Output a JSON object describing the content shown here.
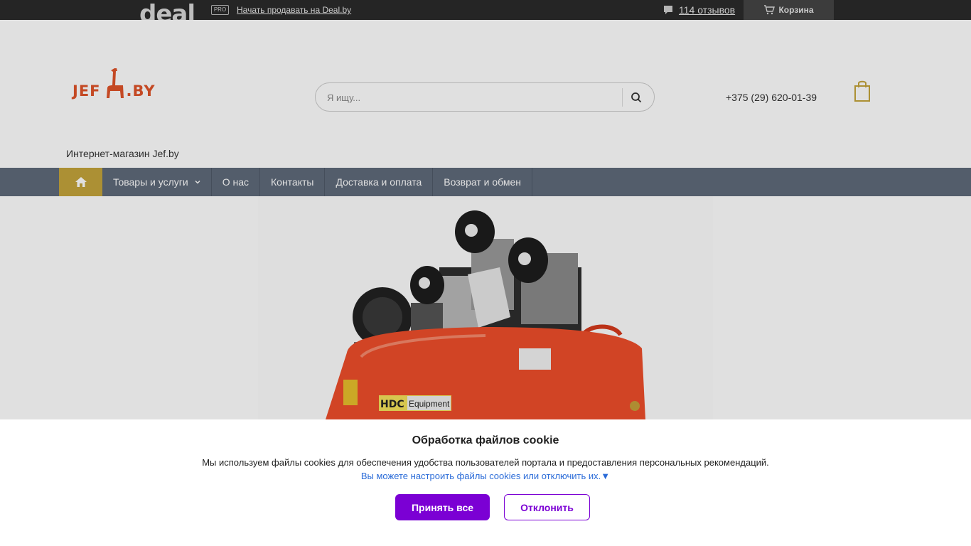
{
  "topbar": {
    "logo_text": "deal",
    "pro_badge": "PRO",
    "sell_link": "Начать продавать на Deal.by",
    "reviews_link": "114 отзывов",
    "cart_label": "Корзина"
  },
  "header": {
    "logo_left": "JEF",
    "logo_right": ".BY",
    "search_placeholder": "Я ищу...",
    "phone": "+375 (29) 620-01-39",
    "shop_name": "Интернет-магазин Jef.by"
  },
  "nav": {
    "items": [
      {
        "label": "Товары и услуги"
      },
      {
        "label": "О нас"
      },
      {
        "label": "Контакты"
      },
      {
        "label": "Доставка и оплата"
      },
      {
        "label": "Возврат и обмен"
      }
    ]
  },
  "product": {
    "brand_plate": "HDC",
    "brand_sub": "Equipment"
  },
  "cookie": {
    "title": "Обработка файлов cookie",
    "text": "Мы используем файлы cookies для обеспечения удобства пользователей портала и предоставления персональных рекомендаций.",
    "link": "Вы можете настроить файлы cookies или отключить их.▼",
    "accept": "Принять все",
    "decline": "Отклонить"
  },
  "colors": {
    "accent": "#7b00d4",
    "nav_bg": "#5f6a7a",
    "home_bg": "#c4a43c",
    "logo": "#e0542a",
    "link": "#2a6bd8"
  }
}
